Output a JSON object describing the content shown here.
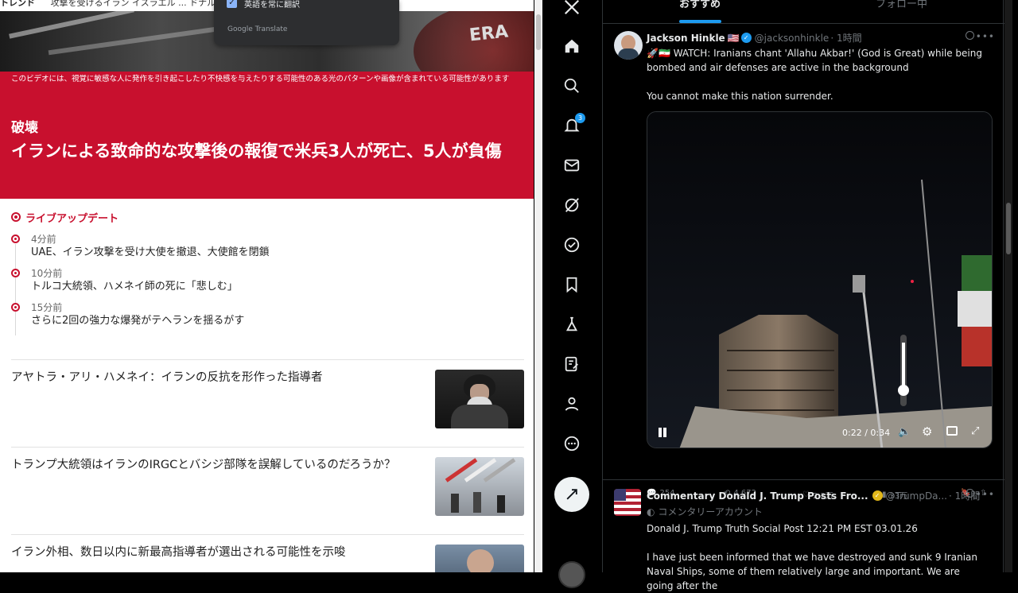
{
  "left_page": {
    "topbar_brand": "トレンド",
    "topbar_links": "攻撃を受けるイラン   イスラエル   ...   ドナルド・トランプ",
    "warning": "このビデオには、視覚に敏感な人に発作を引き起こしたり不快感を与えたりする可能性のある光のパターンや画像が含まれている可能性があります",
    "category": "破壊",
    "headline": "イランによる致命的な攻撃後の報復で米兵3人が死亡、5人が負傷",
    "live_label": "ライブアップデート",
    "updates": [
      {
        "time": "4分前",
        "text": "UAE、イラン攻撃を受け大使を撤退、大使館を閉鎖"
      },
      {
        "time": "10分前",
        "text": "トルコ大統領、ハメネイ師の死に「悲しむ」"
      },
      {
        "time": "15分前",
        "text": "さらに2回の強力な爆発がテヘランを揺るがす"
      }
    ],
    "stories": [
      {
        "title": "アヤトラ・アリ・ハメネイ：イランの反抗を形作った指導者"
      },
      {
        "title": "トランプ大統領はイランのIRGCとバシジ部隊を誤解しているのだろうか？"
      },
      {
        "title": "イラン外相、数日以内に新最高指導者が選出される可能性を示唆"
      }
    ],
    "accent_color": "#c8102e"
  },
  "translate_popup": {
    "checkbox_label": "英語を常に翻訳",
    "footer": "Google Translate"
  },
  "x_app": {
    "notification_count": "3",
    "tabs": {
      "for_you": "おすすめ",
      "following": "フォロー中"
    },
    "post1": {
      "name": "Jackson Hinkle",
      "flag": "🇺🇸",
      "handle": "@jacksonhinkle",
      "time": "· 1時間",
      "text1": "🚀🇮🇷 WATCH: Iranians chant 'Allahu Akbar!' (God is Great) while being bombed and air defenses are active in the background",
      "text2": "You cannot make this nation surrender.",
      "video_time": "0:22 / 0:34",
      "replies": "254",
      "reposts": "4,672",
      "likes": "2.2万",
      "views": "33万"
    },
    "post2": {
      "name": "Commentary Donald J. Trump Posts Fro...",
      "handle": "@TrumpDa...",
      "time": "· 1時間",
      "sublabel": "コメンタリーアカウント",
      "text1": "Donald J. Trump Truth Social Post 12:21 PM EST 03.01.26",
      "text2": "I have just been informed that we have destroyed and sunk 9 Iranian Naval Ships, some of them relatively large and important. We are going after the"
    },
    "verified_color": "#1d9bf0",
    "gold_color": "#e2b719"
  }
}
